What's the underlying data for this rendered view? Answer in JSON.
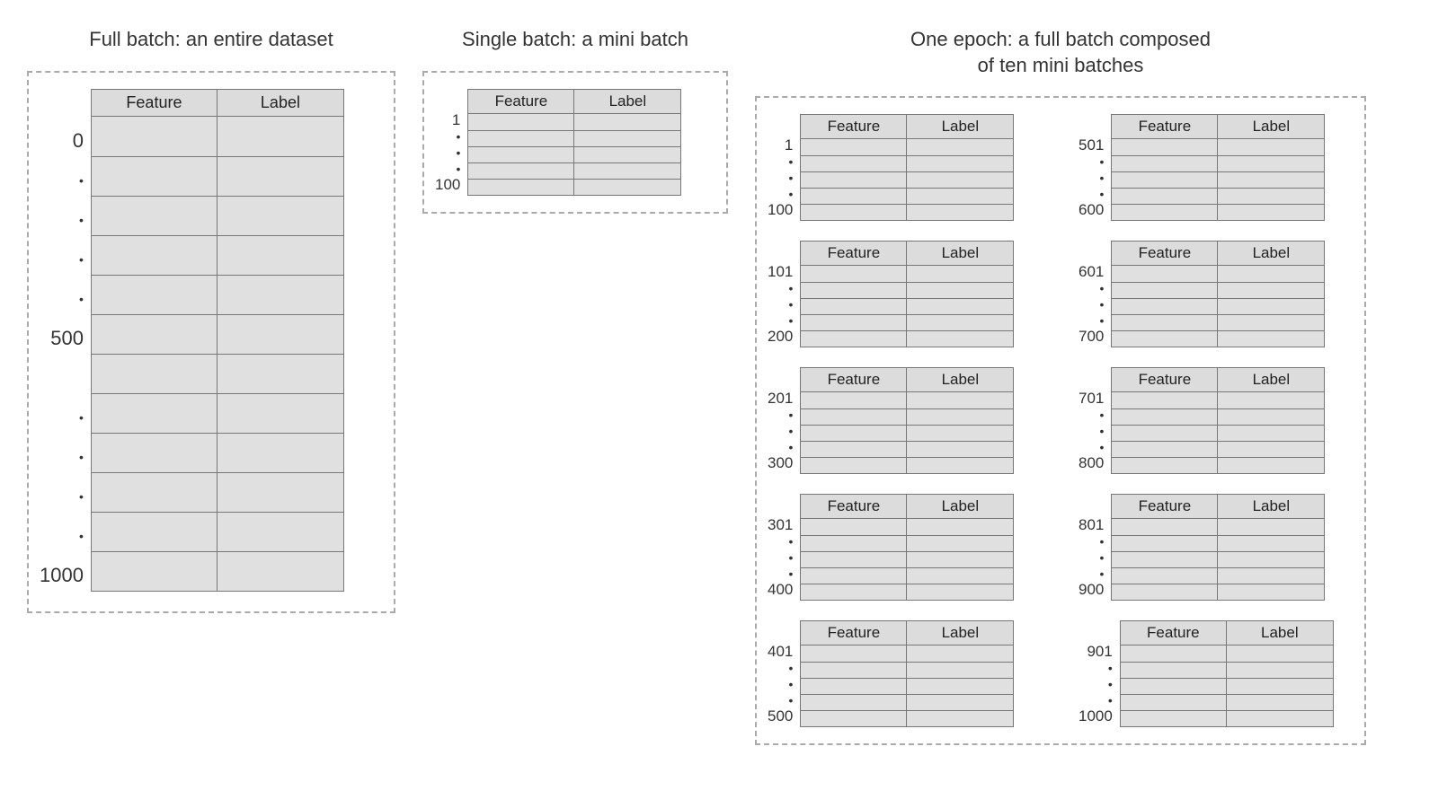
{
  "columns": {
    "feature": "Feature",
    "label": "Label"
  },
  "full": {
    "title": "Full batch: an entire dataset",
    "row_labels": [
      "0",
      "•",
      "•",
      "•",
      "•",
      "500",
      "",
      "•",
      "•",
      "•",
      "•",
      "1000"
    ],
    "n_body_rows": 12
  },
  "single": {
    "title": "Single batch: a mini batch",
    "row_labels": [
      "1",
      "•",
      "•",
      "•",
      "100"
    ],
    "n_body_rows": 5
  },
  "epoch": {
    "title": "One epoch: a full batch composed\nof ten mini batches",
    "minis_col1": [
      {
        "labels": [
          "1",
          "•",
          "•",
          "•",
          "100"
        ]
      },
      {
        "labels": [
          "101",
          "•",
          "•",
          "•",
          "200"
        ]
      },
      {
        "labels": [
          "201",
          "•",
          "•",
          "•",
          "300"
        ]
      },
      {
        "labels": [
          "301",
          "•",
          "•",
          "•",
          "400"
        ]
      },
      {
        "labels": [
          "401",
          "•",
          "•",
          "•",
          "500"
        ]
      }
    ],
    "minis_col2": [
      {
        "labels": [
          "501",
          "•",
          "•",
          "•",
          "600"
        ]
      },
      {
        "labels": [
          "601",
          "•",
          "•",
          "•",
          "700"
        ]
      },
      {
        "labels": [
          "701",
          "•",
          "•",
          "•",
          "800"
        ]
      },
      {
        "labels": [
          "801",
          "•",
          "•",
          "•",
          "900"
        ]
      },
      {
        "labels": [
          "901",
          "•",
          "•",
          "•",
          "1000"
        ]
      }
    ],
    "n_body_rows": 5
  }
}
